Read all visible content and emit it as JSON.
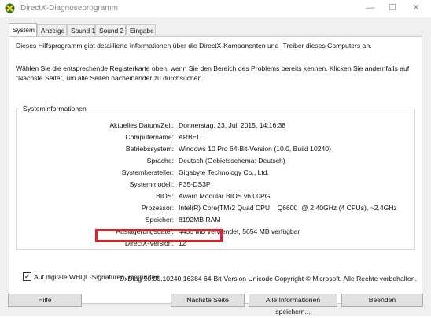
{
  "window": {
    "title": "DirectX-Diagnoseprogramm",
    "minimize": "—",
    "maximize": "☐",
    "close": "✕"
  },
  "tabs": [
    {
      "label": "System",
      "active": true
    },
    {
      "label": "Anzeige",
      "active": false
    },
    {
      "label": "Sound 1",
      "active": false
    },
    {
      "label": "Sound 2",
      "active": false
    },
    {
      "label": "Eingabe",
      "active": false
    }
  ],
  "intro": {
    "line1": "Dieses Hilfsprogramm gibt detaillierte Informationen über die DirectX-Komponenten und -Treiber dieses Computers an.",
    "line2": "Wählen Sie die entsprechende Registerkarte oben, wenn Sie den Bereich des Problems bereits kennen. Klicken Sie andernfalls auf \"Nächste Seite\", um alle Seiten nacheinander zu durchsuchen."
  },
  "system_info": {
    "title": "Systeminformationen",
    "rows": [
      {
        "label": "Aktuelles Datum/Zeit:",
        "value": "Donnerstag, 23. Juli 2015, 14:16:38"
      },
      {
        "label": "Computername:",
        "value": "ARBEIT"
      },
      {
        "label": "Betriebssystem:",
        "value": "Windows 10 Pro 64-Bit-Version (10.0, Build 10240)"
      },
      {
        "label": "Sprache:",
        "value": "Deutsch (Gebietsschema: Deutsch)"
      },
      {
        "label": "Systemhersteller:",
        "value": "Gigabyte Technology Co., Ltd."
      },
      {
        "label": "Systemmodell:",
        "value": "P35-DS3P"
      },
      {
        "label": "BIOS:",
        "value": "Award Modular BIOS v6.00PG"
      },
      {
        "label": "Prozessor:",
        "value": "Intel(R) Core(TM)2 Quad CPU    Q6600  @ 2.40GHz (4 CPUs), ~2.4GHz"
      },
      {
        "label": "Speicher:",
        "value": "8192MB RAM"
      },
      {
        "label": "Auslagerungsdatei:",
        "value": "4455 MB verwendet, 5654 MB verfügbar"
      },
      {
        "label": "DirectX-Version:",
        "value": "12"
      }
    ]
  },
  "whql_checkbox": {
    "label": "Auf digitale WHQL-Signaturen überprüfen",
    "checked": true,
    "mark": "✓"
  },
  "footer": "DxDiag 10.00.10240.16384 64-Bit-Version Unicode Copyright © Microsoft. Alle Rechte vorbehalten.",
  "buttons": {
    "help": "Hilfe",
    "next": "Nächste Seite",
    "save_all": "Alle Informationen speichern...",
    "exit": "Beenden"
  },
  "colors": {
    "highlight_border": "#e0202a",
    "window_bg": "#f0f0f0"
  }
}
